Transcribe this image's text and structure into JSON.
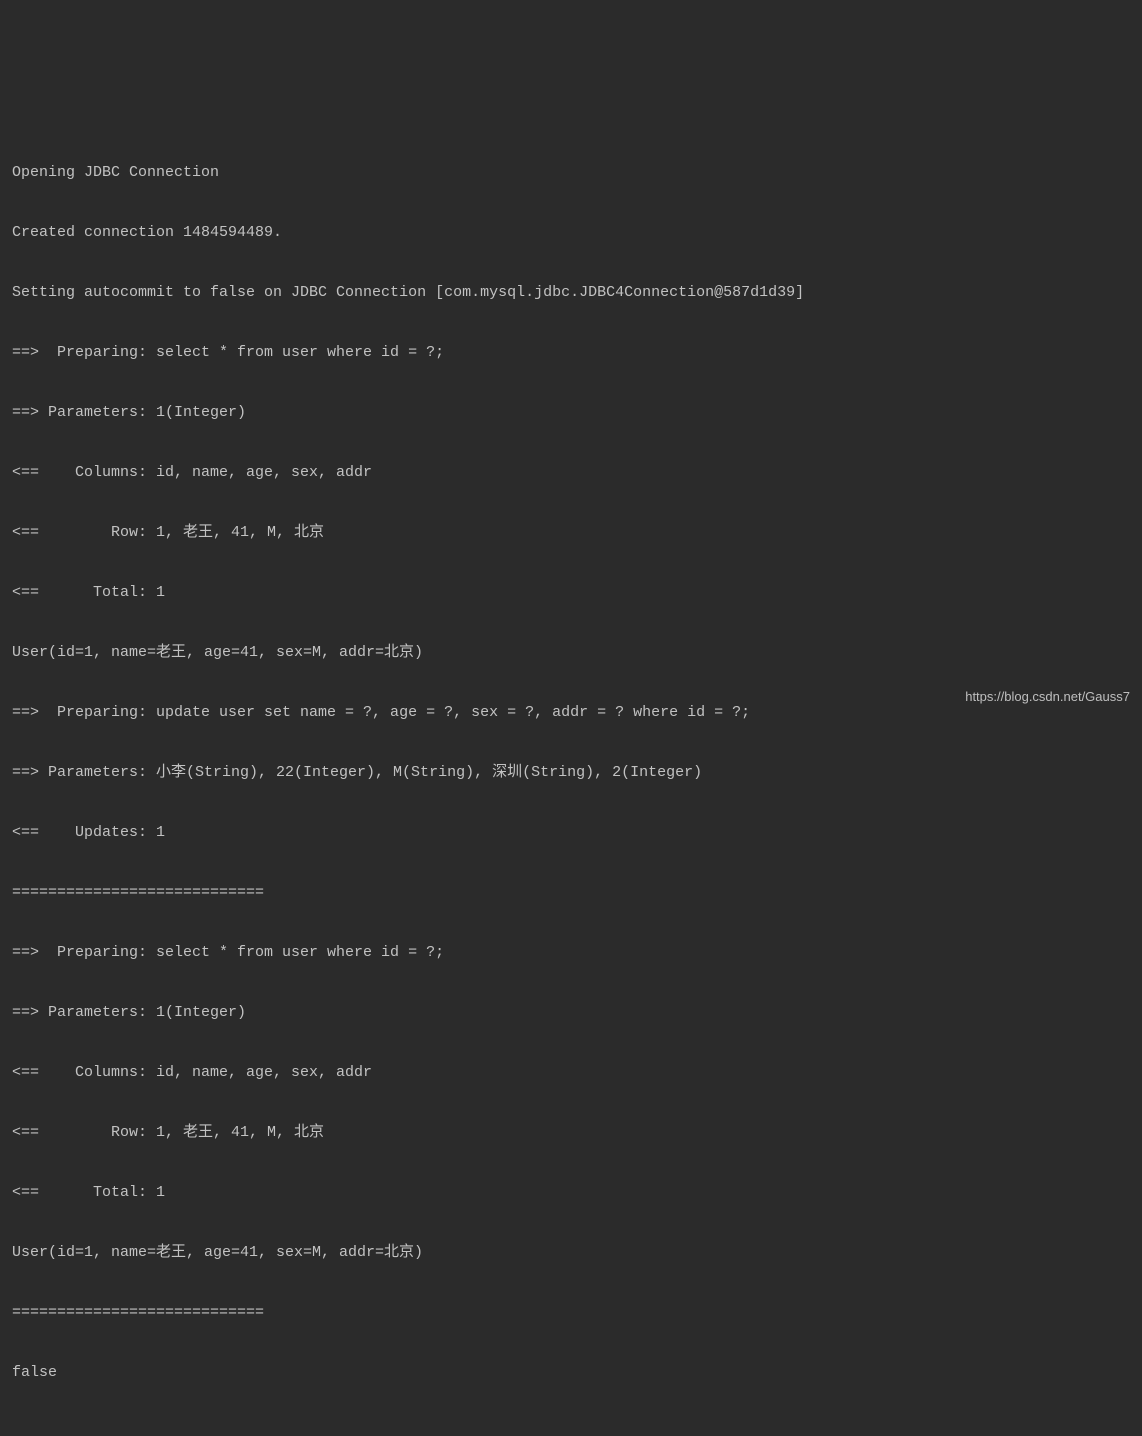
{
  "log": {
    "lines": [
      "Opening JDBC Connection",
      "Created connection 1484594489.",
      "Setting autocommit to false on JDBC Connection [com.mysql.jdbc.JDBC4Connection@587d1d39]",
      "==>  Preparing: select * from user where id = ?;",
      "==> Parameters: 1(Integer)",
      "<==    Columns: id, name, age, sex, addr",
      "<==        Row: 1, 老王, 41, M, 北京",
      "<==      Total: 1",
      "User(id=1, name=老王, age=41, sex=M, addr=北京)",
      "==>  Preparing: update user set name = ?, age = ?, sex = ?, addr = ? where id = ?;",
      "==> Parameters: 小李(String), 22(Integer), M(String), 深圳(String), 2(Integer)",
      "<==    Updates: 1",
      "============================",
      "==>  Preparing: select * from user where id = ?;",
      "==> Parameters: 1(Integer)",
      "<==    Columns: id, name, age, sex, addr",
      "<==        Row: 1, 老王, 41, M, 北京",
      "<==      Total: 1",
      "User(id=1, name=老王, age=41, sex=M, addr=北京)",
      "============================",
      "false"
    ]
  },
  "watermark": "https://blog.csdn.net/Gauss7"
}
